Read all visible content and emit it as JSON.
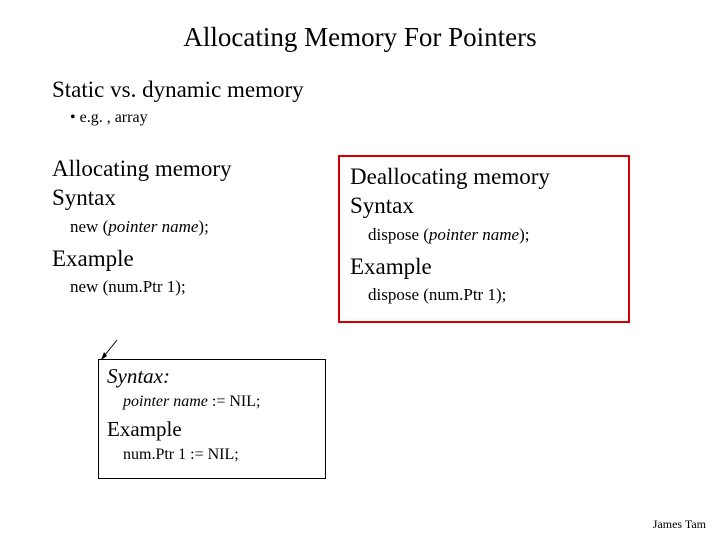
{
  "title": "Allocating Memory For Pointers",
  "sub1": "Static vs. dynamic memory",
  "bullet1": "• e.g. , array",
  "left": {
    "h1": "Allocating memory",
    "h2": "Syntax",
    "code1a": "new (",
    "code1b": "pointer name",
    "code1c": ");",
    "h3": "Example",
    "code2": "new (num.Ptr 1);"
  },
  "right": {
    "h1": "Deallocating memory",
    "h2": "Syntax",
    "code1a": "dispose (",
    "code1b": "pointer name",
    "code1c": ");",
    "h3": "Example",
    "code2": "dispose (num.Ptr 1);"
  },
  "box": {
    "h1": "Syntax:",
    "code1a": "pointer name",
    "code1b": " := NIL;",
    "h2": "Example",
    "code2": "num.Ptr 1 := NIL;"
  },
  "footer": "James Tam"
}
